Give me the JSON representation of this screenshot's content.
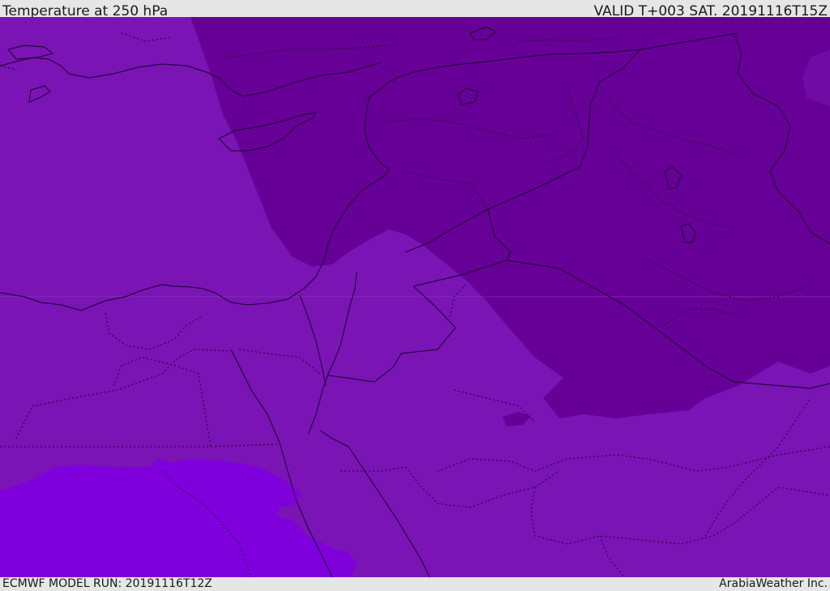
{
  "header": {
    "title": "Temperature at 250 hPa",
    "valid": "VALID T+003 SAT. 20191116T15Z"
  },
  "footer": {
    "model_run": "ECMWF MODEL RUN: 20191116T12Z",
    "credit": "ArabiaWeather Inc."
  },
  "colors": {
    "field_mid": "#7a14b4",
    "field_cold": "#670096",
    "field_warm": "#7f00dc",
    "border_line": "#1a0030"
  }
}
